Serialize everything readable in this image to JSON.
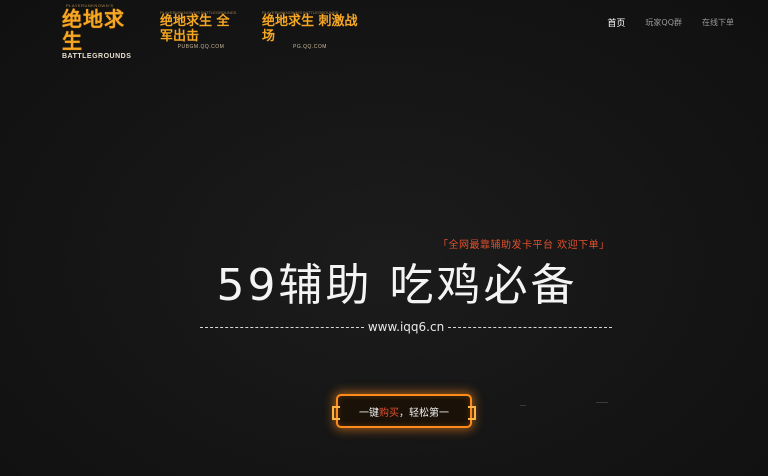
{
  "header": {
    "logo_main": {
      "top_text": "PLAYERUNKNOWN'S",
      "cn": "绝地求生",
      "en": "BATTLEGROUNDS"
    },
    "logo_sub_1": {
      "top_text": "PLAYERUNKNOWN'S BATTLEGROUNDS",
      "cn": "绝地求生 全军出击",
      "url": "PUBGM.QQ.COM"
    },
    "logo_sub_2": {
      "top_text": "PLAYERUNKNOWN'S BATTLEGROUNDS",
      "cn": "绝地求生 刺激战场",
      "url": "PG.QQ.COM"
    },
    "nav": [
      {
        "label": "首页",
        "active": true
      },
      {
        "label": "玩家QQ群",
        "active": false
      },
      {
        "label": "在线下单",
        "active": false
      }
    ]
  },
  "hero": {
    "tagline": "「全网最靠辅助发卡平台 欢迎下单」",
    "title": "59辅助  吃鸡必备",
    "site_url": "www.iqq6.cn"
  },
  "cta": {
    "prefix": "一键",
    "highlight": "购买",
    "suffix": "，轻松第一"
  },
  "colors": {
    "accent_orange": "#f5a623",
    "cta_border": "#ff8c1a",
    "highlight_red": "#e0502e",
    "background": "#141414"
  }
}
